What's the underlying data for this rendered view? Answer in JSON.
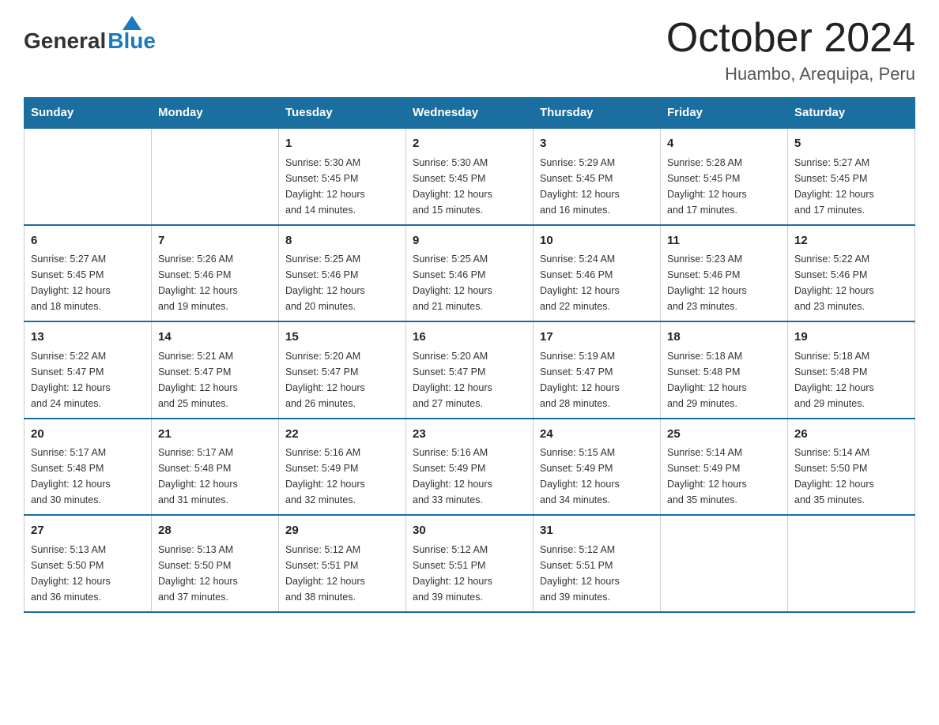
{
  "logo": {
    "general": "General",
    "blue": "Blue"
  },
  "title": "October 2024",
  "location": "Huambo, Arequipa, Peru",
  "headers": [
    "Sunday",
    "Monday",
    "Tuesday",
    "Wednesday",
    "Thursday",
    "Friday",
    "Saturday"
  ],
  "weeks": [
    [
      {
        "day": "",
        "info": ""
      },
      {
        "day": "",
        "info": ""
      },
      {
        "day": "1",
        "info": "Sunrise: 5:30 AM\nSunset: 5:45 PM\nDaylight: 12 hours\nand 14 minutes."
      },
      {
        "day": "2",
        "info": "Sunrise: 5:30 AM\nSunset: 5:45 PM\nDaylight: 12 hours\nand 15 minutes."
      },
      {
        "day": "3",
        "info": "Sunrise: 5:29 AM\nSunset: 5:45 PM\nDaylight: 12 hours\nand 16 minutes."
      },
      {
        "day": "4",
        "info": "Sunrise: 5:28 AM\nSunset: 5:45 PM\nDaylight: 12 hours\nand 17 minutes."
      },
      {
        "day": "5",
        "info": "Sunrise: 5:27 AM\nSunset: 5:45 PM\nDaylight: 12 hours\nand 17 minutes."
      }
    ],
    [
      {
        "day": "6",
        "info": "Sunrise: 5:27 AM\nSunset: 5:45 PM\nDaylight: 12 hours\nand 18 minutes."
      },
      {
        "day": "7",
        "info": "Sunrise: 5:26 AM\nSunset: 5:46 PM\nDaylight: 12 hours\nand 19 minutes."
      },
      {
        "day": "8",
        "info": "Sunrise: 5:25 AM\nSunset: 5:46 PM\nDaylight: 12 hours\nand 20 minutes."
      },
      {
        "day": "9",
        "info": "Sunrise: 5:25 AM\nSunset: 5:46 PM\nDaylight: 12 hours\nand 21 minutes."
      },
      {
        "day": "10",
        "info": "Sunrise: 5:24 AM\nSunset: 5:46 PM\nDaylight: 12 hours\nand 22 minutes."
      },
      {
        "day": "11",
        "info": "Sunrise: 5:23 AM\nSunset: 5:46 PM\nDaylight: 12 hours\nand 23 minutes."
      },
      {
        "day": "12",
        "info": "Sunrise: 5:22 AM\nSunset: 5:46 PM\nDaylight: 12 hours\nand 23 minutes."
      }
    ],
    [
      {
        "day": "13",
        "info": "Sunrise: 5:22 AM\nSunset: 5:47 PM\nDaylight: 12 hours\nand 24 minutes."
      },
      {
        "day": "14",
        "info": "Sunrise: 5:21 AM\nSunset: 5:47 PM\nDaylight: 12 hours\nand 25 minutes."
      },
      {
        "day": "15",
        "info": "Sunrise: 5:20 AM\nSunset: 5:47 PM\nDaylight: 12 hours\nand 26 minutes."
      },
      {
        "day": "16",
        "info": "Sunrise: 5:20 AM\nSunset: 5:47 PM\nDaylight: 12 hours\nand 27 minutes."
      },
      {
        "day": "17",
        "info": "Sunrise: 5:19 AM\nSunset: 5:47 PM\nDaylight: 12 hours\nand 28 minutes."
      },
      {
        "day": "18",
        "info": "Sunrise: 5:18 AM\nSunset: 5:48 PM\nDaylight: 12 hours\nand 29 minutes."
      },
      {
        "day": "19",
        "info": "Sunrise: 5:18 AM\nSunset: 5:48 PM\nDaylight: 12 hours\nand 29 minutes."
      }
    ],
    [
      {
        "day": "20",
        "info": "Sunrise: 5:17 AM\nSunset: 5:48 PM\nDaylight: 12 hours\nand 30 minutes."
      },
      {
        "day": "21",
        "info": "Sunrise: 5:17 AM\nSunset: 5:48 PM\nDaylight: 12 hours\nand 31 minutes."
      },
      {
        "day": "22",
        "info": "Sunrise: 5:16 AM\nSunset: 5:49 PM\nDaylight: 12 hours\nand 32 minutes."
      },
      {
        "day": "23",
        "info": "Sunrise: 5:16 AM\nSunset: 5:49 PM\nDaylight: 12 hours\nand 33 minutes."
      },
      {
        "day": "24",
        "info": "Sunrise: 5:15 AM\nSunset: 5:49 PM\nDaylight: 12 hours\nand 34 minutes."
      },
      {
        "day": "25",
        "info": "Sunrise: 5:14 AM\nSunset: 5:49 PM\nDaylight: 12 hours\nand 35 minutes."
      },
      {
        "day": "26",
        "info": "Sunrise: 5:14 AM\nSunset: 5:50 PM\nDaylight: 12 hours\nand 35 minutes."
      }
    ],
    [
      {
        "day": "27",
        "info": "Sunrise: 5:13 AM\nSunset: 5:50 PM\nDaylight: 12 hours\nand 36 minutes."
      },
      {
        "day": "28",
        "info": "Sunrise: 5:13 AM\nSunset: 5:50 PM\nDaylight: 12 hours\nand 37 minutes."
      },
      {
        "day": "29",
        "info": "Sunrise: 5:12 AM\nSunset: 5:51 PM\nDaylight: 12 hours\nand 38 minutes."
      },
      {
        "day": "30",
        "info": "Sunrise: 5:12 AM\nSunset: 5:51 PM\nDaylight: 12 hours\nand 39 minutes."
      },
      {
        "day": "31",
        "info": "Sunrise: 5:12 AM\nSunset: 5:51 PM\nDaylight: 12 hours\nand 39 minutes."
      },
      {
        "day": "",
        "info": ""
      },
      {
        "day": "",
        "info": ""
      }
    ]
  ]
}
